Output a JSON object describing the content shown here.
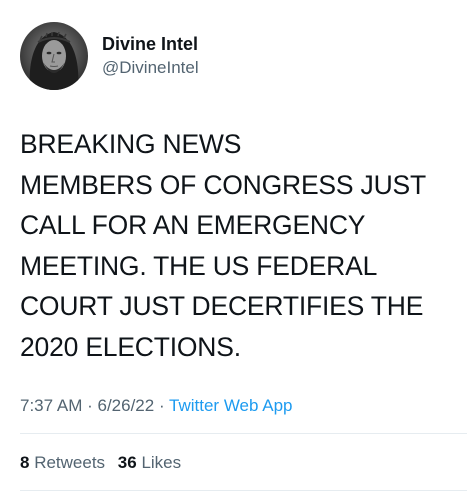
{
  "tweet": {
    "author": {
      "display_name": "Divine Intel",
      "handle": "@DivineIntel",
      "avatar_icon": "avatar-portrait-icon"
    },
    "text_lines": [
      "BREAKING NEWS",
      "MEMBERS OF CONGRESS JUST",
      "CALL FOR AN EMERGENCY",
      "MEETING. THE US FEDERAL",
      "COURT JUST DECERTIFIES THE",
      "2020 ELECTIONS."
    ],
    "meta": {
      "time": "7:37 AM",
      "separator": " · ",
      "date": "6/26/22",
      "source": "Twitter Web App"
    },
    "stats": {
      "retweets_count": "8",
      "retweets_label": " Retweets",
      "likes_count": "36",
      "likes_label": " Likes"
    }
  },
  "colors": {
    "text_primary": "#0f1419",
    "text_secondary": "#536471",
    "link": "#1d9bf0",
    "divider": "#e6ecf0",
    "background": "#ffffff"
  }
}
